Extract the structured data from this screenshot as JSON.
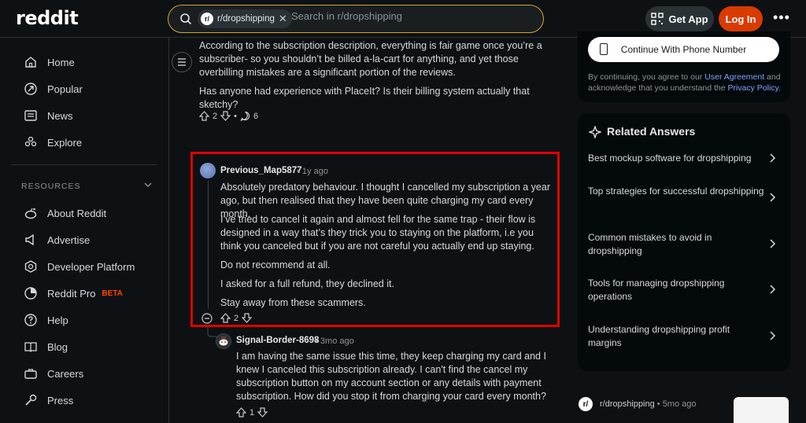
{
  "header": {
    "logo": "reddit",
    "search_chip": "r/dropshipping",
    "search_placeholder": "Search in r/dropshipping",
    "get_app": "Get App",
    "login": "Log In"
  },
  "leftnav": {
    "items": [
      {
        "label": "Home",
        "icon": "home-icon"
      },
      {
        "label": "Popular",
        "icon": "popular-icon"
      },
      {
        "label": "News",
        "icon": "news-icon"
      },
      {
        "label": "Explore",
        "icon": "explore-icon"
      }
    ],
    "resources_heading": "RESOURCES",
    "resources": [
      {
        "label": "About Reddit"
      },
      {
        "label": "Advertise"
      },
      {
        "label": "Developer Platform"
      },
      {
        "label": "Reddit Pro",
        "badge": "BETA"
      },
      {
        "label": "Help"
      },
      {
        "label": "Blog"
      },
      {
        "label": "Careers"
      },
      {
        "label": "Press"
      }
    ]
  },
  "top_comment": {
    "para1": "According to the subscription description, everything is fair game once you’re a subscriber- so you shouldn’t be billed a-la-cart for anything, and yet those overbilling mistakes are a significant portion of the reviews.",
    "para2": "Has anyone had experience with PlaceIt? Is their billing system actually that sketchy?",
    "votes": "2",
    "comments": "6"
  },
  "highlighted_comment": {
    "author": "Previous_Map5877",
    "age": "• 1y ago",
    "paragraphs": [
      "Absolutely predatory behaviour. I thought I cancelled my subscription a year ago, but then realised that they have been quite charging my card every month.",
      "I’ve tried to cancel it again and almost fell for the same trap - their flow is designed in a way that’s they trick you to staying on the platform, i.e you think you canceled but if you are not careful you actually end up staying.",
      "Do not recommend at all.",
      "I asked for a full refund, they declined it.",
      "Stay away from these scammers."
    ],
    "votes": "2"
  },
  "reply_comment": {
    "author": "Signal-Border-8698",
    "age": "• 3mo ago",
    "text": "I am having the same issue this time, they keep charging my card and I knew I canceled this subscription already. I can't find the cancel my subscription button on my account section or any details with payment subscription. How did you stop it from charging your card every month?",
    "votes": "1"
  },
  "sidebar": {
    "phone_button": "Continue With Phone Number",
    "terms_prefix": "By continuing, you agree to our ",
    "terms_link1": "User Agreement",
    "terms_mid": " and acknowledge that you understand the ",
    "terms_link2": "Privacy Policy",
    "terms_suffix": ".",
    "related_title": "Related Answers",
    "related": [
      "Best mockup software for dropshipping",
      "Top strategies for successful dropshipping",
      "Common mistakes to avoid in dropshipping",
      "Tools for managing dropshipping operations",
      "Understanding dropshipping profit margins"
    ],
    "bottom_sub": "r/dropshipping",
    "bottom_age": "• 5mo ago"
  },
  "colors": {
    "background": "#0e1113",
    "accent": "#d93a00",
    "highlight_border": "#e00000",
    "search_border": "#d4a531"
  }
}
